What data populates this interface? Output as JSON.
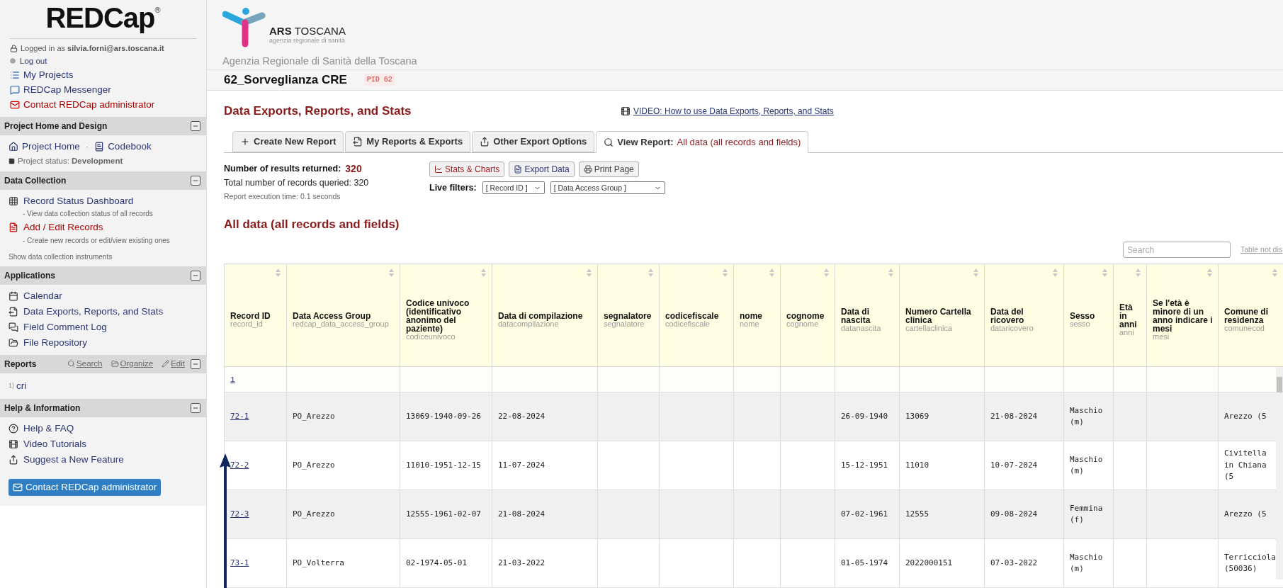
{
  "sidebar": {
    "logo": {
      "text": "REDCap",
      "mark": "®"
    },
    "account": {
      "logged_in": "Logged in as **silvia.forni@ars.toscana.it**",
      "logout": "Log out"
    },
    "top_links": [
      {
        "label": "My Projects",
        "kind": "projects",
        "alert": false
      },
      {
        "label": "REDCap Messenger",
        "kind": "messenger",
        "alert": false
      },
      {
        "label": "Contact REDCap administrator",
        "kind": "mail",
        "alert": true
      }
    ],
    "sections": [
      {
        "title": "Project Home and Design",
        "kind": "project",
        "links": [
          {
            "label": "Project Home",
            "kind": "home"
          },
          {
            "label": "Codebook",
            "kind": "codebook"
          }
        ],
        "separator": "·",
        "status": "Project status: **Development**"
      },
      {
        "title": "Data Collection",
        "kind": "collection",
        "items": [
          {
            "label": "Record Status Dashboard",
            "desc": "- View data collection status of all records",
            "kind": "grid",
            "alert": false
          },
          {
            "label": "Add / Edit Records",
            "desc": "- Create new records or edit/view existing ones",
            "kind": "file",
            "alert": true
          }
        ],
        "footer": "Show data collection instruments"
      },
      {
        "title": "Applications",
        "kind": "list",
        "items": [
          {
            "label": "Calendar",
            "kind": "calendar"
          },
          {
            "label": "Data Exports, Reports, and Stats",
            "kind": "export"
          },
          {
            "label": "Field Comment Log",
            "kind": "comments"
          },
          {
            "label": "File Repository",
            "kind": "folder"
          }
        ]
      },
      {
        "title": "Reports",
        "kind": "reports",
        "actions": [
          {
            "label": "Search",
            "kind": "search"
          },
          {
            "label": "Organize",
            "kind": "folder"
          },
          {
            "label": "Edit",
            "kind": "edit"
          }
        ],
        "reports": [
          {
            "number": "1)",
            "label": "cri"
          }
        ]
      },
      {
        "title": "Help & Information",
        "kind": "list",
        "items": [
          {
            "label": "Help & FAQ",
            "kind": "help"
          },
          {
            "label": "Video Tutorials",
            "kind": "film"
          },
          {
            "label": "Suggest a New Feature",
            "kind": "share"
          }
        ],
        "button": "Contact REDCap administrator"
      }
    ]
  },
  "header": {
    "brand_bold": "ARS",
    "brand": "TOSCANA",
    "brand_sub": "agenzia regionale di sanità",
    "org": "Agenzia Regionale di Sanità della Toscana"
  },
  "project": {
    "title": "62_Sorveglianza CRE",
    "pid": "PID 62"
  },
  "page": {
    "title": "Data Exports, Reports, and Stats",
    "video_link": "VIDEO: How to use Data Exports, Reports, and Stats"
  },
  "tabs": [
    {
      "label": "Create New Report",
      "kind": "plus",
      "selected": false
    },
    {
      "label": "My Reports & Exports",
      "kind": "export",
      "selected": false
    },
    {
      "label": "Other Export Options",
      "kind": "share",
      "selected": false
    },
    {
      "label": "View Report:",
      "detail": "All data (all records and fields)",
      "kind": "search",
      "selected": true
    }
  ],
  "summary": {
    "returned_label": "Number of results returned:",
    "returned": "320",
    "queried": "Total number of records queried: 320",
    "time": "Report execution time: 0.1 seconds"
  },
  "actions": [
    {
      "label": "Stats & Charts",
      "kind": "chart"
    },
    {
      "label": "Export Data",
      "kind": "file"
    },
    {
      "label": "Print Page",
      "kind": "print"
    }
  ],
  "live_filters": {
    "label": "Live filters:",
    "filters": [
      "[ Record ID ]",
      "[ Data Access Group ]"
    ]
  },
  "report": {
    "title": "All data (all records and fields)",
    "search_placeholder": "Search",
    "table_note": "Table not dis",
    "columns": [
      {
        "label": "Record ID",
        "variable": "record_id"
      },
      {
        "label": "Data Access Group",
        "variable": "redcap_data_access_group"
      },
      {
        "label": "Codice univoco (identificativo anonimo del paziente)",
        "variable": "codiceunivoco"
      },
      {
        "label": "Data di compilazione",
        "variable": "datacompilazione"
      },
      {
        "label": "segnalatore",
        "variable": "segnalatore"
      },
      {
        "label": "codicefiscale",
        "variable": "codicefiscale"
      },
      {
        "label": "nome",
        "variable": "nome"
      },
      {
        "label": "cognome",
        "variable": "cognome"
      },
      {
        "label": "Data di nascita",
        "variable": "datanascita"
      },
      {
        "label": "Numero Cartella clinica",
        "variable": "cartellaclinica"
      },
      {
        "label": "Data del ricovero",
        "variable": "dataricovero"
      },
      {
        "label": "Sesso",
        "variable": "sesso"
      },
      {
        "label": "Età in anni",
        "variable": "anni"
      },
      {
        "label": "Se l'età è minore di un anno indicare i mesi",
        "variable": "mesi"
      },
      {
        "label": "Comune di residenza",
        "variable": "comunecod"
      }
    ],
    "group_row": "1",
    "rows": [
      {
        "cells": [
          "72-1",
          "PO_Arezzo",
          "13069-1940-09-26",
          "22-08-2024",
          null,
          null,
          null,
          null,
          "26-09-1940",
          "13069",
          "21-08-2024",
          "Maschio (m)",
          null,
          null,
          "Arezzo (5"
        ]
      },
      {
        "cells": [
          "72-2",
          "PO_Arezzo",
          "11010-1951-12-15",
          "11-07-2024",
          null,
          null,
          null,
          null,
          "15-12-1951",
          "11010",
          "10-07-2024",
          "Maschio (m)",
          null,
          null,
          "Civitella in Chiana (5"
        ]
      },
      {
        "cells": [
          "72-3",
          "PO_Arezzo",
          "12555-1961-02-07",
          "21-08-2024",
          null,
          null,
          null,
          null,
          "07-02-1961",
          "12555",
          "09-08-2024",
          "Femmina (f)",
          null,
          null,
          "Arezzo (5"
        ]
      },
      {
        "cells": [
          "73-1",
          "PO_Volterra",
          "02-1974-05-01",
          "21-03-2022",
          null,
          null,
          null,
          null,
          "01-05-1974",
          "2022000151",
          "07-03-2022",
          "Maschio (m)",
          null,
          null,
          "Terricciola (50036)"
        ]
      }
    ]
  }
}
